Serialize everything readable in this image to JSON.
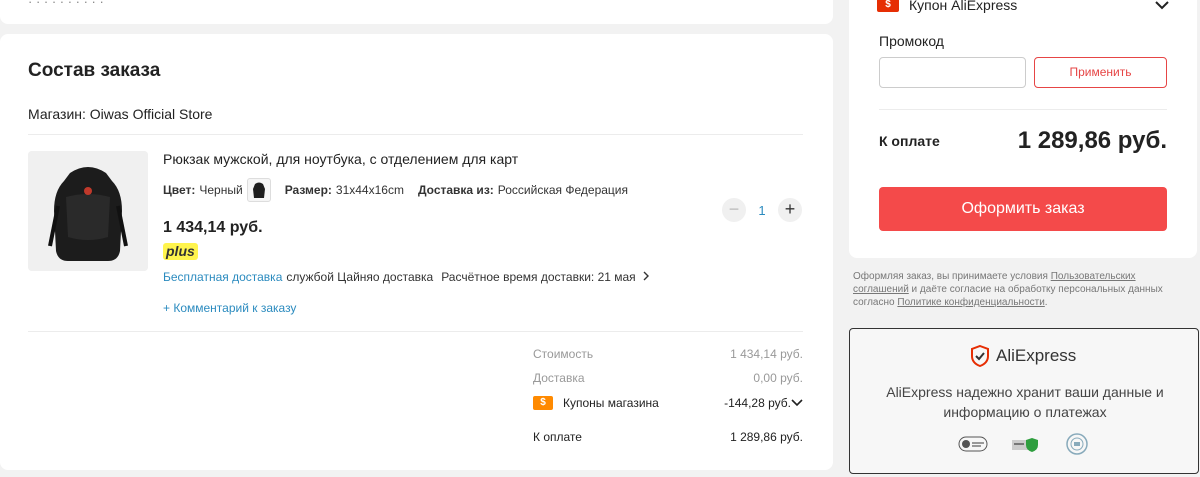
{
  "top_card": {
    "crumb": "· · · · · · · · · ·"
  },
  "order": {
    "title": "Состав заказа",
    "store": "Магазин: Oiwas Official Store",
    "product": {
      "title": "Рюкзак мужской, для ноутбука, с отделением для карт",
      "color_label": "Цвет:",
      "color_value": "Черный",
      "size_label": "Размер:",
      "size_value": "31x44x16cm",
      "ship_from_label": "Доставка из:",
      "ship_from_value": "Российская Федерация",
      "price": "1 434,14 руб.",
      "plus_badge": "plus",
      "free_delivery": "Бесплатная доставка",
      "delivery_service": "службой Цайняо доставка",
      "delivery_eta": "Расчётное время доставки: 21 мая",
      "comment_link": "+ Комментарий к заказу",
      "quantity": "1"
    },
    "summary": {
      "cost_label": "Стоимость",
      "cost_value": "1 434,14 руб.",
      "delivery_label": "Доставка",
      "delivery_value": "0,00 руб.",
      "store_coupons_label": "Купоны магазина",
      "store_coupons_value": "-144,28 руб.",
      "total_label": "К оплате",
      "total_value": "1 289,86 руб."
    }
  },
  "sidebar": {
    "coupon_header": "Купон AliExpress",
    "promo_label": "Промокод",
    "promo_value": "",
    "apply_button": "Применить",
    "pay_label": "К оплате",
    "pay_total": "1 289,86 руб.",
    "checkout_button": "Оформить заказ",
    "legal": {
      "part1": "Оформляя заказ, вы принимаете условия ",
      "link1": "Пользовательских соглашений",
      "part2": " и даёте согласие на обработку персональных данных согласно ",
      "link2": "Политике конфиденциальности",
      "part3": "."
    },
    "secure": {
      "brand": "AliExpress",
      "text": "AliExpress надежно хранит ваши данные и информацию о платежах"
    }
  },
  "colors": {
    "accent": "#f44a4a",
    "link": "#2b8bbf",
    "coupon_orange": "#ff8a00",
    "plus_yellow": "#fff44d"
  }
}
